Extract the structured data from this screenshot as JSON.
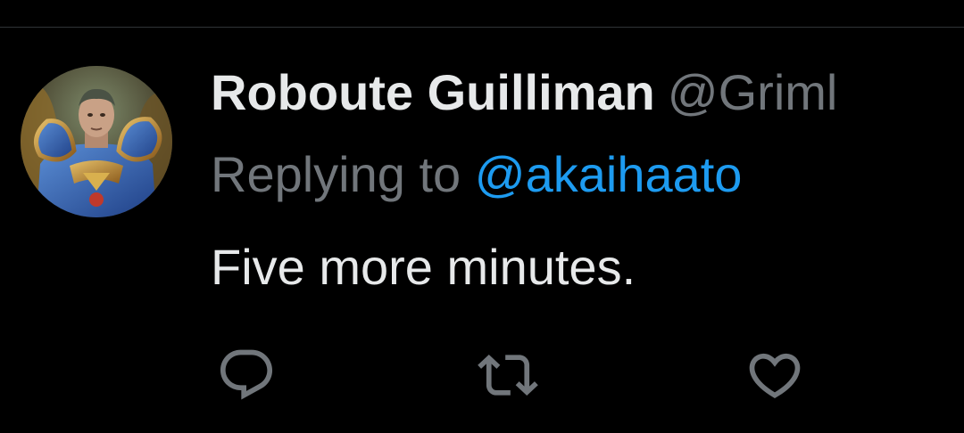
{
  "tweet": {
    "author": {
      "display_name": "Roboute Guilliman",
      "handle": "@Griml"
    },
    "reply": {
      "prefix": "Replying to ",
      "mention": "@akaihaato"
    },
    "text": "Five more minutes.",
    "actions": [
      {
        "name": "reply",
        "icon": "reply-icon"
      },
      {
        "name": "retweet",
        "icon": "retweet-icon"
      },
      {
        "name": "like",
        "icon": "heart-icon"
      }
    ]
  },
  "colors": {
    "background": "#000000",
    "primary_text": "#e7e9ea",
    "secondary_text": "#71767b",
    "accent": "#1d9bf0",
    "divider": "#2f3336"
  }
}
